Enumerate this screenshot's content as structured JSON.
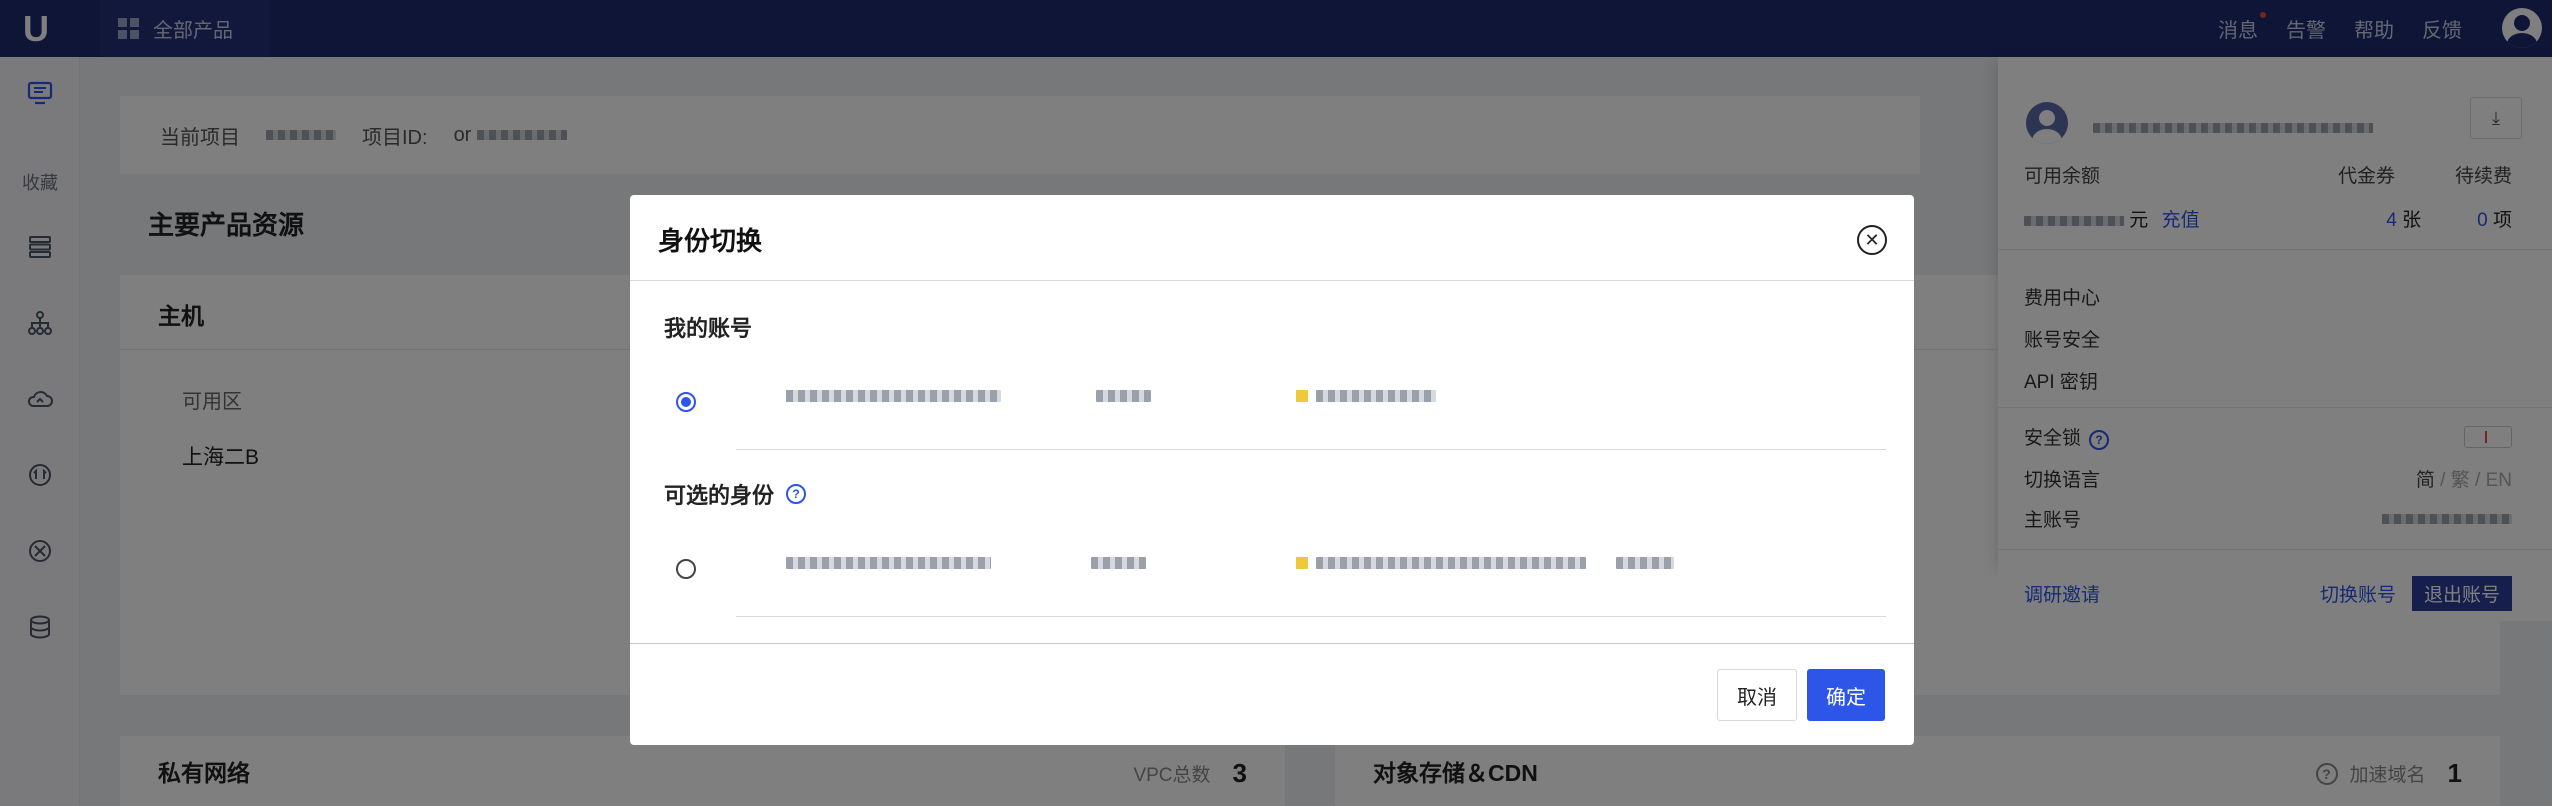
{
  "topbar": {
    "logo": "U",
    "all_products": "全部产品",
    "nav": [
      "消息",
      "告警",
      "帮助",
      "反馈"
    ]
  },
  "sidebar": {
    "favorites_label": "收藏",
    "icons": [
      "monitor-icon",
      "server-list-icon",
      "org-tree-icon",
      "cloud-icon",
      "network-icon",
      "compass-icon",
      "database-icon"
    ]
  },
  "page": {
    "project_label": "当前项目",
    "project_id_label": "项目ID:",
    "project_id_prefix": "or",
    "main_resources": "主要产品资源",
    "host": {
      "title": "主机",
      "zone_header": "可用区",
      "zone_value": "上海二B"
    },
    "vpc": {
      "title": "私有网络",
      "total_label": "VPC总数",
      "total_value": "3"
    },
    "cdn": {
      "title": "对象存储＆CDN",
      "domain_label": "加速域名",
      "domain_value": "1"
    }
  },
  "account_panel": {
    "balance_label": "可用余额",
    "voucher_label": "代金券",
    "renewal_label": "待续费",
    "currency": "元",
    "recharge": "充值",
    "voucher_value": "4",
    "voucher_unit": "张",
    "renewal_value": "0",
    "renewal_unit": "项",
    "menu": [
      "费用中心",
      "账号安全",
      "API 密钥"
    ],
    "security_lock": "安全锁",
    "switch_language": "切换语言",
    "lang_options": [
      "简",
      "/",
      "繁",
      "/",
      "EN"
    ],
    "main_account": "主账号",
    "survey": "调研邀请",
    "switch_account": "切换账号",
    "logout": "退出账号"
  },
  "modal": {
    "title": "身份切换",
    "my_account": "我的账号",
    "optional_identities": "可选的身份",
    "cancel": "取消",
    "confirm": "确定",
    "selected_row": 0
  },
  "colors": {
    "topbar": "#1f2a6e",
    "accent": "#2d55e8",
    "logout_button": "#2d3d9a"
  }
}
